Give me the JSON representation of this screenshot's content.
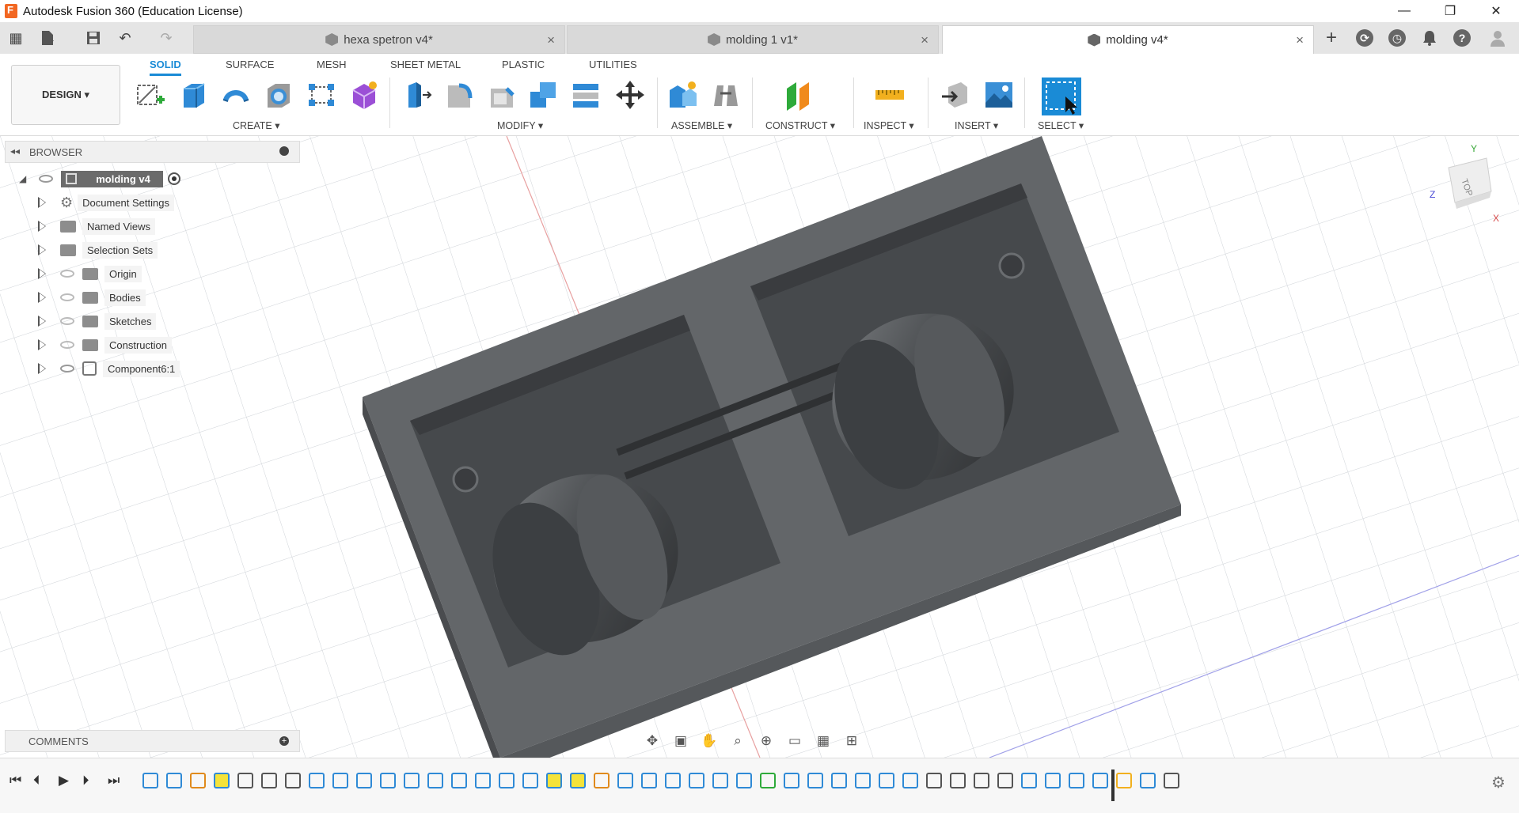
{
  "window": {
    "title": "Autodesk Fusion 360 (Education License)",
    "minimize": "—",
    "restore": "❐",
    "close": "✕"
  },
  "tabs": [
    {
      "label": "hexa spetron v4*",
      "active": false
    },
    {
      "label": "molding 1 v1*",
      "active": false
    },
    {
      "label": "molding v4*",
      "active": true
    }
  ],
  "tab_close": "×",
  "ribbon": {
    "workspace": "DESIGN ▾",
    "tabs": [
      "SOLID",
      "SURFACE",
      "MESH",
      "SHEET METAL",
      "PLASTIC",
      "UTILITIES"
    ],
    "groups": [
      "CREATE ▾",
      "MODIFY ▾",
      "ASSEMBLE ▾",
      "CONSTRUCT ▾",
      "INSPECT ▾",
      "INSERT ▾",
      "SELECT ▾"
    ]
  },
  "browser": {
    "title": "BROWSER",
    "root": "molding v4",
    "items": [
      {
        "label": "Document Settings",
        "icon": "gear-icon"
      },
      {
        "label": "Named Views",
        "icon": "folder-icon"
      },
      {
        "label": "Selection Sets",
        "icon": "folder-icon"
      },
      {
        "label": "Origin",
        "icon": "folder-icon"
      },
      {
        "label": "Bodies",
        "icon": "folder-icon"
      },
      {
        "label": "Sketches",
        "icon": "folder-icon"
      },
      {
        "label": "Construction",
        "icon": "folder-icon"
      },
      {
        "label": "Component6:1",
        "icon": "component-icon"
      }
    ]
  },
  "comments": {
    "title": "COMMENTS"
  },
  "viewcube": {
    "face": "TOP",
    "axis_z": "Z",
    "axis_x": "X",
    "axis_y": "Y"
  },
  "colors": {
    "accent": "#1a8bd6",
    "model": "#5e6163",
    "highlight": "#f4e33a"
  }
}
